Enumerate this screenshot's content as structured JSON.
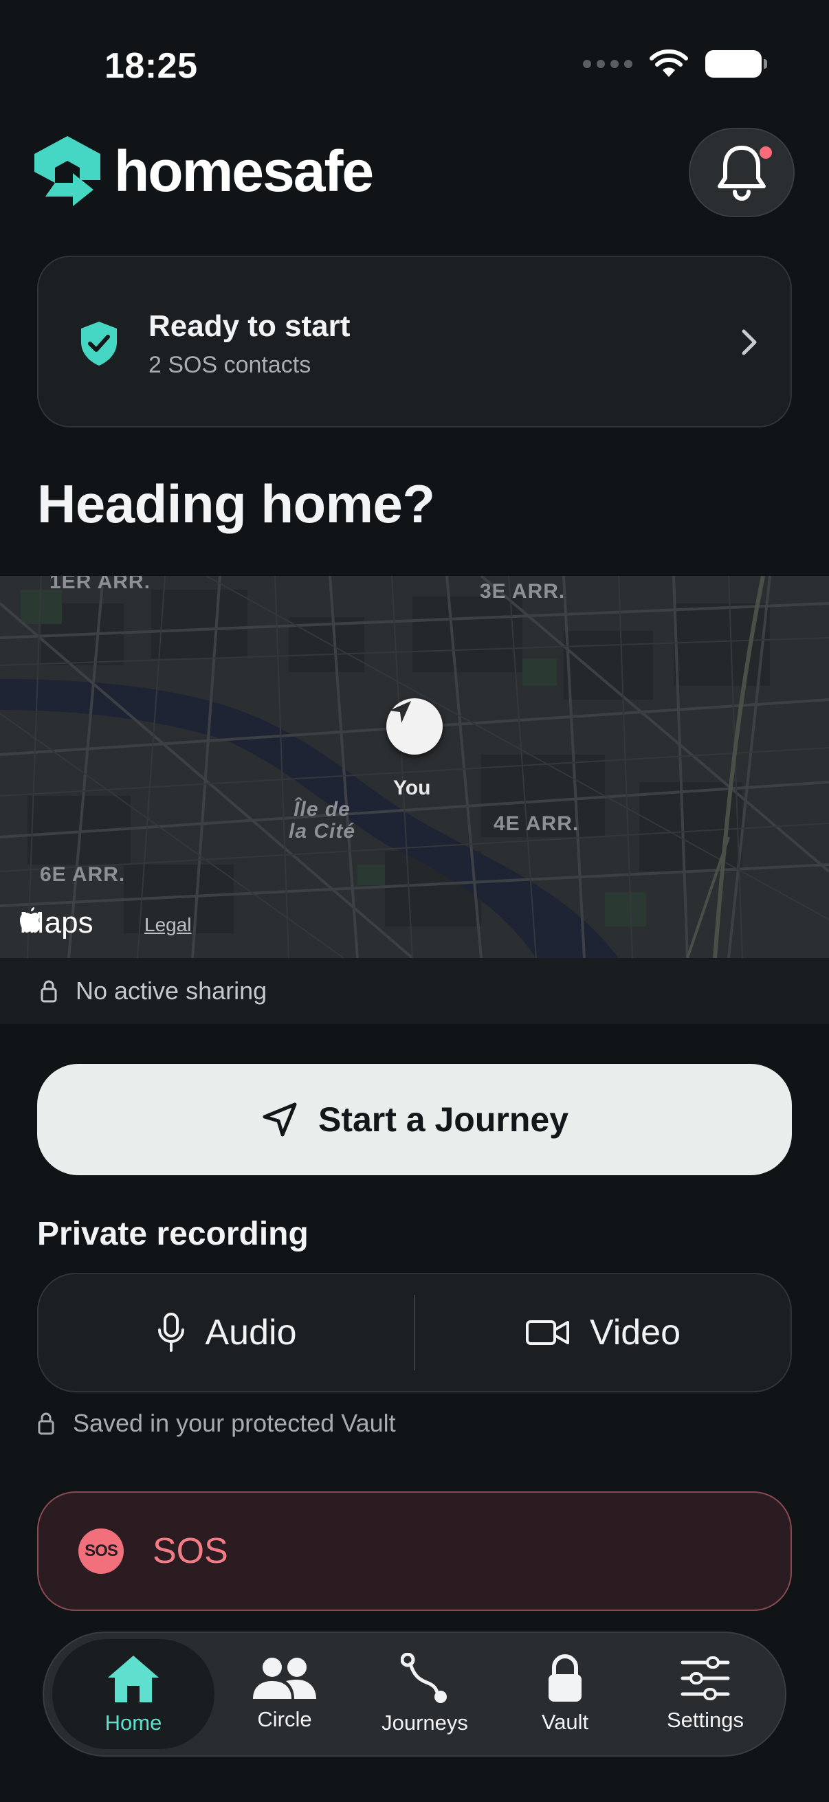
{
  "status_bar": {
    "time": "18:25"
  },
  "brand": {
    "name": "homesafe",
    "accent": "#45d6c4"
  },
  "ready_card": {
    "title": "Ready to start",
    "subtitle": "2 SOS contacts"
  },
  "heading": "Heading home?",
  "map": {
    "labels": {
      "arr1": "1ER ARR.",
      "arr3": "3E ARR.",
      "arr4": "4E ARR.",
      "arr6": "6E ARR.",
      "island_line1": "Île de",
      "island_line2": "la Cité"
    },
    "you_label": "You",
    "brand": "Maps",
    "legal": "Legal"
  },
  "sharing_status": "No active sharing",
  "journey_button": {
    "label": "Start a Journey"
  },
  "private_recording": {
    "title": "Private recording",
    "audio_label": "Audio",
    "video_label": "Video",
    "note": "Saved in your protected Vault"
  },
  "sos": {
    "badge": "SOS",
    "label": "SOS",
    "color": "#f37c87"
  },
  "tabs": [
    {
      "label": "Home",
      "icon": "home-icon",
      "active": true
    },
    {
      "label": "Circle",
      "icon": "people-icon",
      "active": false
    },
    {
      "label": "Journeys",
      "icon": "route-icon",
      "active": false
    },
    {
      "label": "Vault",
      "icon": "lock-icon",
      "active": false
    },
    {
      "label": "Settings",
      "icon": "sliders-icon",
      "active": false
    }
  ]
}
